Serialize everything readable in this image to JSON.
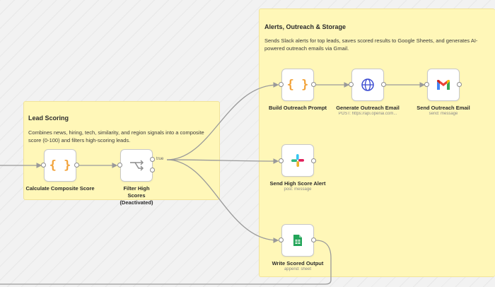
{
  "sticky_notes": {
    "lead_scoring": {
      "title": "Lead Scoring",
      "description": "Combines news, hiring, tech, similarity, and region signals into a composite score (0-100) and filters high-scoring leads."
    },
    "alerts": {
      "title": "Alerts, Outreach & Storage",
      "description": "Sends Slack alerts for top leads, saves scored results to Google Sheets, and generates AI-powered outreach emails via Gmail."
    }
  },
  "nodes": {
    "calculate_composite": {
      "label": "Calculate Composite Score",
      "icon": "code-braces-icon"
    },
    "filter_high_scores": {
      "label": "Filter High Scores (Deactivated)",
      "icon": "filter-branch-icon",
      "true_label": "true"
    },
    "build_outreach_prompt": {
      "label": "Build Outreach Prompt",
      "icon": "code-braces-icon"
    },
    "generate_outreach_email": {
      "label": "Generate Outreach Email",
      "subtitle": "POST: https://api.openai.com...",
      "icon": "globe-icon"
    },
    "send_outreach_email": {
      "label": "Send Outreach Email",
      "subtitle": "send: message",
      "icon": "gmail-icon"
    },
    "send_high_score_alert": {
      "label": "Send High Score Alert",
      "subtitle": "post: message",
      "icon": "slack-icon"
    },
    "write_scored_output": {
      "label": "Write Scored Output",
      "subtitle": "append: sheet",
      "icon": "google-sheets-icon"
    }
  },
  "colors": {
    "sticky_bg": "#fff7b8",
    "code_icon": "#f2a33a",
    "globe_icon": "#3b4bd1",
    "edge": "#9a9a9a",
    "sheets_green": "#23a55a"
  }
}
